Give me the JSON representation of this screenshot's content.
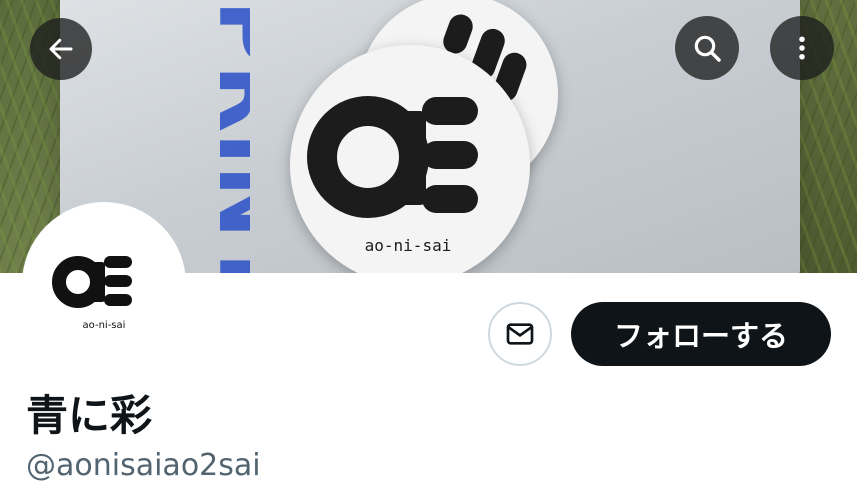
{
  "banner": {
    "sticker_text": "ao-ni-sai",
    "bag_text": "PRINT"
  },
  "avatar": {
    "logo_text": "ao-ni-sai"
  },
  "header": {
    "back_icon": "arrow-left-icon",
    "search_icon": "search-icon",
    "more_icon": "more-vertical-icon"
  },
  "actions": {
    "message_icon": "mail-icon",
    "follow_label": "フォローする"
  },
  "profile": {
    "display_name": "青に彩",
    "handle": "@aonisaiao2sai"
  },
  "colors": {
    "follow_bg": "#0f1419",
    "handle": "#536471",
    "brand_blue": "#2a50c8"
  }
}
